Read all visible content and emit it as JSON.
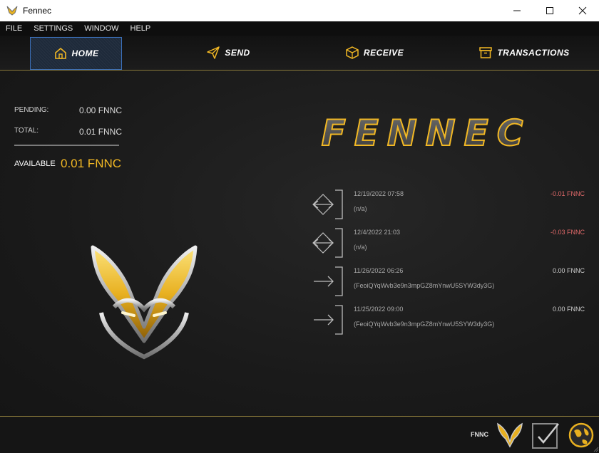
{
  "window": {
    "title": "Fennec"
  },
  "menu": [
    "FILE",
    "SETTINGS",
    "WINDOW",
    "HELP"
  ],
  "nav": {
    "home": "HOME",
    "send": "SEND",
    "receive": "RECEIVE",
    "transactions": "TRANSACTIONS"
  },
  "balances": {
    "pending_label": "PENDING:",
    "pending_value": "0.00 FNNC",
    "total_label": "TOTAL:",
    "total_value": "0.01 FNNC",
    "available_label": "AVAILABLE",
    "available_value": "0.01 FNNC"
  },
  "brand": "FENNEC",
  "transactions": [
    {
      "date": "12/19/2022 07:58",
      "address": "(n/a)",
      "amount": "-0.01 FNNC",
      "type": "self",
      "amount_color": "#e26a6a"
    },
    {
      "date": "12/4/2022 21:03",
      "address": "(n/a)",
      "amount": "-0.03 FNNC",
      "type": "self",
      "amount_color": "#e26a6a"
    },
    {
      "date": "11/26/2022 06:26",
      "address": "(FeoiQYqWvb3e9n3mpGZ8mYnwU5SYW3dy3G)",
      "amount": "0.00 FNNC",
      "type": "received",
      "amount_color": "#d0d0d0"
    },
    {
      "date": "11/25/2022 09:00",
      "address": "(FeoiQYqWvb3e9n3mpGZ8mYnwU5SYW3dy3G)",
      "amount": "0.00 FNNC",
      "type": "received",
      "amount_color": "#d0d0d0"
    }
  ],
  "footer": {
    "unit": "FNNC"
  },
  "colors": {
    "accent": "#f2b824",
    "active_nav": "#3b6fb8",
    "negative": "#e26a6a"
  }
}
